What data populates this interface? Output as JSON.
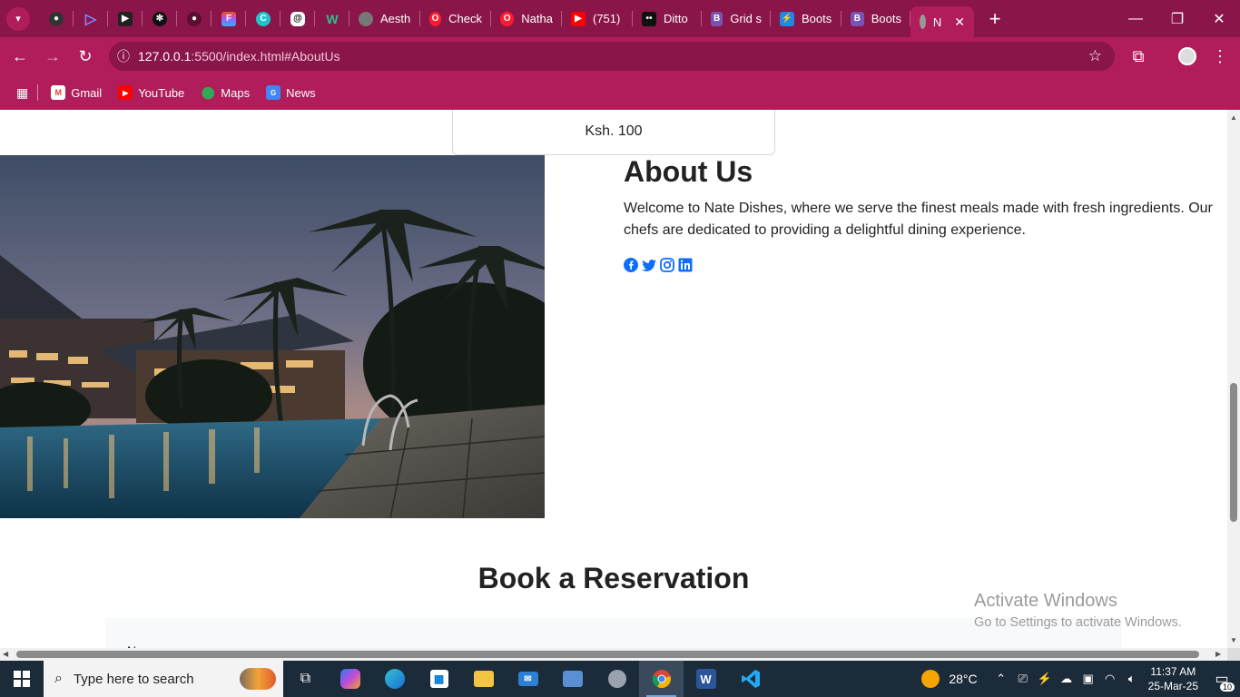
{
  "browser": {
    "tabs": [
      {
        "label": "Aesth",
        "icon": "globe-icon"
      },
      {
        "label": "Check",
        "icon": "opera-icon"
      },
      {
        "label": "Natha",
        "icon": "opera-icon"
      },
      {
        "label": "(751)",
        "icon": "youtube-icon"
      },
      {
        "label": "Ditto",
        "icon": "ditto-icon"
      },
      {
        "label": "Grid s",
        "icon": "bootstrap-icon"
      },
      {
        "label": "Boots",
        "icon": "bolt-icon"
      },
      {
        "label": "Boots",
        "icon": "bootstrap-icon"
      },
      {
        "label": "N",
        "icon": "globe-icon",
        "active": true
      }
    ],
    "url_host": "127.0.0.1",
    "url_path": ":5500/index.html#AboutUs",
    "bookmarks": [
      "Gmail",
      "YouTube",
      "Maps",
      "News"
    ]
  },
  "page": {
    "price": "Ksh. 100",
    "about": {
      "title": "About Us",
      "text": "Welcome to Nate Dishes, where we serve the finest meals made with fresh ingredients. Our chefs are dedicated to providing a delightful dining experience.",
      "socials": [
        "facebook-icon",
        "twitter-icon",
        "instagram-icon",
        "linkedin-icon"
      ]
    },
    "reservation": {
      "title": "Book a Reservation",
      "first_label": "N"
    },
    "watermark": {
      "line1": "Activate Windows",
      "line2": "Go to Settings to activate Windows."
    }
  },
  "taskbar": {
    "search_placeholder": "Type here to search",
    "weather": "28°C",
    "time": "11:37 AM",
    "date": "25-Mar-25",
    "notifications": "10"
  },
  "colors": {
    "chrome_dark": "#8a1548",
    "chrome": "#b01d5a",
    "accent_link": "#0d6efd"
  }
}
